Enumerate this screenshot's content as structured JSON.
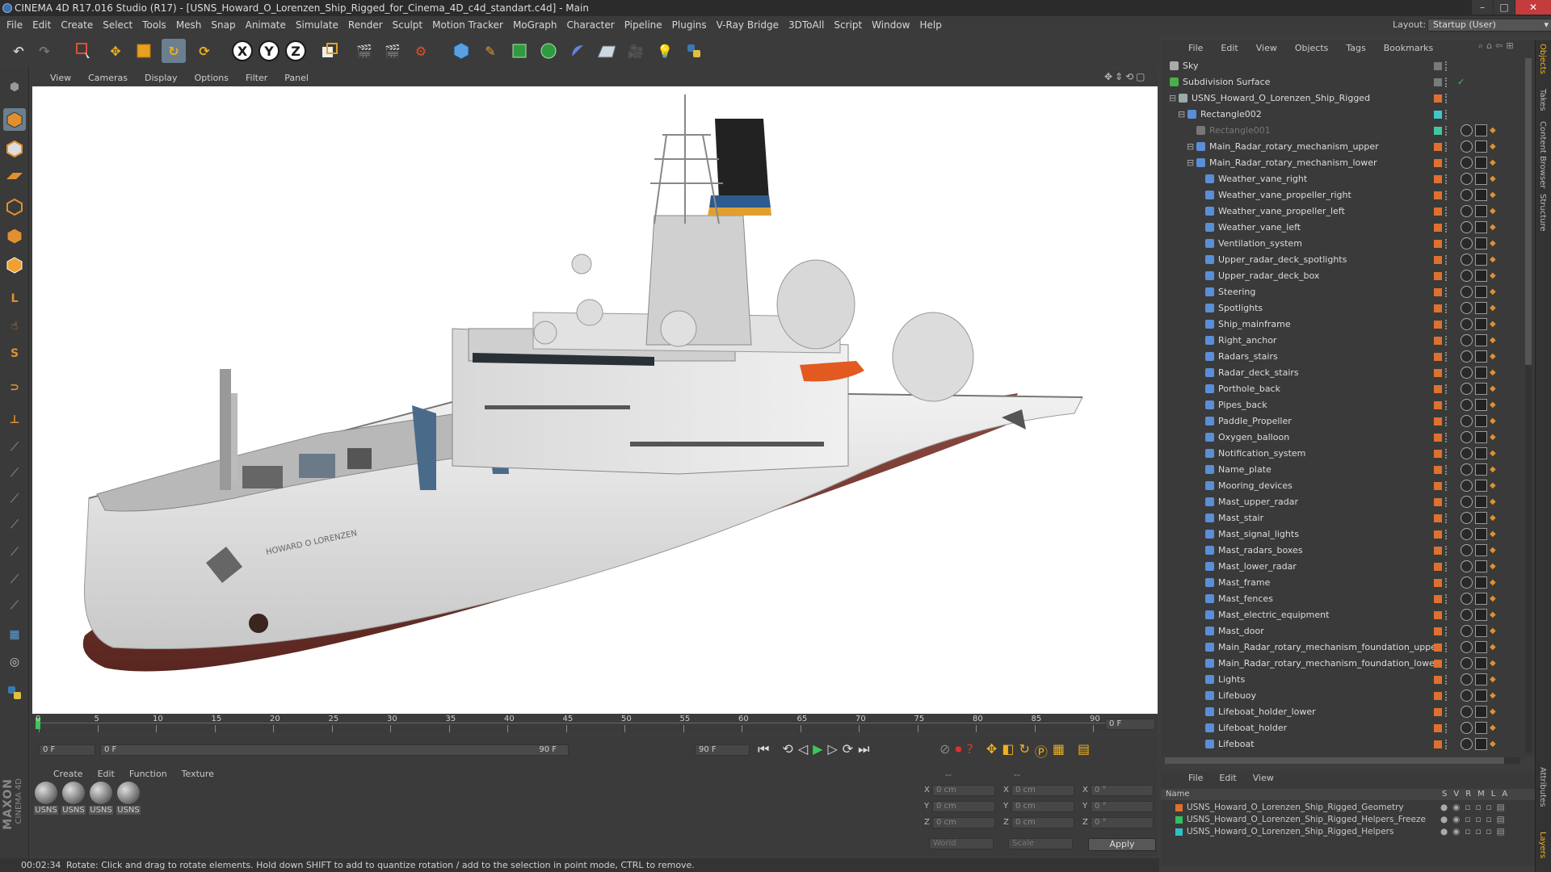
{
  "window": {
    "title": "CINEMA 4D R17.016 Studio (R17) - [USNS_Howard_O_Lorenzen_Ship_Rigged_for_Cinema_4D_c4d_standart.c4d] - Main",
    "min": "–",
    "max": "□",
    "close": "✕"
  },
  "menu": [
    "File",
    "Edit",
    "Create",
    "Select",
    "Tools",
    "Mesh",
    "Snap",
    "Animate",
    "Simulate",
    "Render",
    "Sculpt",
    "Motion Tracker",
    "MoGraph",
    "Character",
    "Pipeline",
    "Plugins",
    "V-Ray Bridge",
    "3DToAll",
    "Script",
    "Window",
    "Help"
  ],
  "layout": {
    "label": "Layout:",
    "value": "Startup (User)"
  },
  "toolbar": {
    "x_axis": "X",
    "y_axis": "Y",
    "z_axis": "Z"
  },
  "viewport_menu": [
    "View",
    "Cameras",
    "Display",
    "Options",
    "Filter",
    "Panel"
  ],
  "ship": {
    "name_plate": "HOWARD O LORENZEN"
  },
  "timeline": {
    "ticks": [
      "0",
      "5",
      "10",
      "15",
      "20",
      "25",
      "30",
      "35",
      "40",
      "45",
      "50",
      "55",
      "60",
      "65",
      "70",
      "75",
      "80",
      "85",
      "90"
    ],
    "current_frame_display": "0 F"
  },
  "timectrl": {
    "start": "0 F",
    "range_start": "0 F",
    "range_end": "90 F",
    "end": "90 F"
  },
  "materials": {
    "menu": [
      "Create",
      "Edit",
      "Function",
      "Texture"
    ],
    "items": [
      "USNS",
      "USNS",
      "USNS",
      "USNS"
    ]
  },
  "coords": {
    "labels": [
      "X",
      "Y",
      "Z",
      "X",
      "Y",
      "Z",
      "X",
      "Y",
      "Z"
    ],
    "values": [
      "0 cm",
      "0 cm",
      "0 cm",
      "0 cm",
      "0 cm",
      "0 cm",
      "0 °",
      "0 °",
      "0 °"
    ],
    "dash1": "--",
    "dash2": "--",
    "mode1": "World",
    "mode2": "Scale",
    "apply": "Apply"
  },
  "status": {
    "time": "00:02:34",
    "message": "Rotate: Click and drag to rotate elements. Hold down SHIFT to add to quantize rotation / add to the selection in point mode, CTRL to remove."
  },
  "objects_menu": [
    "File",
    "Edit",
    "View",
    "Objects",
    "Tags",
    "Bookmarks"
  ],
  "objects": [
    {
      "name": "Sky",
      "indent": 0,
      "color": "#7a7a7a",
      "icon": "#aaaaaa"
    },
    {
      "name": "Subdivision Surface",
      "indent": 0,
      "color": "#7a7a7a",
      "icon": "#48b04a"
    },
    {
      "name": "USNS_Howard_O_Lorenzen_Ship_Rigged",
      "indent": 1,
      "color": "#e07030",
      "icon": "#9aa"
    },
    {
      "name": "Rectangle002",
      "indent": 2,
      "color": "#40c8c8",
      "icon": "#5a8fd8"
    },
    {
      "name": "Rectangle001",
      "indent": 3,
      "color": "#40c8a0",
      "icon": "#777",
      "dim": true
    },
    {
      "name": "Main_Radar_rotary_mechanism_upper",
      "indent": 3,
      "color": "#e07030",
      "icon": "#5a8fd8"
    },
    {
      "name": "Main_Radar_rotary_mechanism_lower",
      "indent": 3,
      "color": "#e07030",
      "icon": "#5a8fd8"
    },
    {
      "name": "Weather_vane_right",
      "indent": 4,
      "color": "#e07030",
      "icon": "#5a8fd8"
    },
    {
      "name": "Weather_vane_propeller_right",
      "indent": 4,
      "color": "#e07030",
      "icon": "#5a8fd8"
    },
    {
      "name": "Weather_vane_propeller_left",
      "indent": 4,
      "color": "#e07030",
      "icon": "#5a8fd8"
    },
    {
      "name": "Weather_vane_left",
      "indent": 4,
      "color": "#e07030",
      "icon": "#5a8fd8"
    },
    {
      "name": "Ventilation_system",
      "indent": 4,
      "color": "#e07030",
      "icon": "#5a8fd8"
    },
    {
      "name": "Upper_radar_deck_spotlights",
      "indent": 4,
      "color": "#e07030",
      "icon": "#5a8fd8"
    },
    {
      "name": "Upper_radar_deck_box",
      "indent": 4,
      "color": "#e07030",
      "icon": "#5a8fd8"
    },
    {
      "name": "Steering",
      "indent": 4,
      "color": "#e07030",
      "icon": "#5a8fd8"
    },
    {
      "name": "Spotlights",
      "indent": 4,
      "color": "#e07030",
      "icon": "#5a8fd8"
    },
    {
      "name": "Ship_mainframe",
      "indent": 4,
      "color": "#e07030",
      "icon": "#5a8fd8"
    },
    {
      "name": "Right_anchor",
      "indent": 4,
      "color": "#e07030",
      "icon": "#5a8fd8"
    },
    {
      "name": "Radars_stairs",
      "indent": 4,
      "color": "#e07030",
      "icon": "#5a8fd8"
    },
    {
      "name": "Radar_deck_stairs",
      "indent": 4,
      "color": "#e07030",
      "icon": "#5a8fd8"
    },
    {
      "name": "Porthole_back",
      "indent": 4,
      "color": "#e07030",
      "icon": "#5a8fd8"
    },
    {
      "name": "Pipes_back",
      "indent": 4,
      "color": "#e07030",
      "icon": "#5a8fd8"
    },
    {
      "name": "Paddle_Propeller",
      "indent": 4,
      "color": "#e07030",
      "icon": "#5a8fd8"
    },
    {
      "name": "Oxygen_balloon",
      "indent": 4,
      "color": "#e07030",
      "icon": "#5a8fd8"
    },
    {
      "name": "Notification_system",
      "indent": 4,
      "color": "#e07030",
      "icon": "#5a8fd8"
    },
    {
      "name": "Name_plate",
      "indent": 4,
      "color": "#e07030",
      "icon": "#5a8fd8"
    },
    {
      "name": "Mooring_devices",
      "indent": 4,
      "color": "#e07030",
      "icon": "#5a8fd8"
    },
    {
      "name": "Mast_upper_radar",
      "indent": 4,
      "color": "#e07030",
      "icon": "#5a8fd8"
    },
    {
      "name": "Mast_stair",
      "indent": 4,
      "color": "#e07030",
      "icon": "#5a8fd8"
    },
    {
      "name": "Mast_signal_lights",
      "indent": 4,
      "color": "#e07030",
      "icon": "#5a8fd8"
    },
    {
      "name": "Mast_radars_boxes",
      "indent": 4,
      "color": "#e07030",
      "icon": "#5a8fd8"
    },
    {
      "name": "Mast_lower_radar",
      "indent": 4,
      "color": "#e07030",
      "icon": "#5a8fd8"
    },
    {
      "name": "Mast_frame",
      "indent": 4,
      "color": "#e07030",
      "icon": "#5a8fd8"
    },
    {
      "name": "Mast_fences",
      "indent": 4,
      "color": "#e07030",
      "icon": "#5a8fd8"
    },
    {
      "name": "Mast_electric_equipment",
      "indent": 4,
      "color": "#e07030",
      "icon": "#5a8fd8"
    },
    {
      "name": "Mast_door",
      "indent": 4,
      "color": "#e07030",
      "icon": "#5a8fd8"
    },
    {
      "name": "Main_Radar_rotary_mechanism_foundation_upper",
      "indent": 4,
      "color": "#e07030",
      "icon": "#5a8fd8"
    },
    {
      "name": "Main_Radar_rotary_mechanism_foundation_lower",
      "indent": 4,
      "color": "#e07030",
      "icon": "#5a8fd8"
    },
    {
      "name": "Lights",
      "indent": 4,
      "color": "#e07030",
      "icon": "#5a8fd8"
    },
    {
      "name": "Lifebuoy",
      "indent": 4,
      "color": "#e07030",
      "icon": "#5a8fd8"
    },
    {
      "name": "Lifeboat_holder_lower",
      "indent": 4,
      "color": "#e07030",
      "icon": "#5a8fd8"
    },
    {
      "name": "Lifeboat_holder",
      "indent": 4,
      "color": "#e07030",
      "icon": "#5a8fd8"
    },
    {
      "name": "Lifeboat",
      "indent": 4,
      "color": "#e07030",
      "icon": "#5a8fd8"
    }
  ],
  "layers": {
    "menu": [
      "File",
      "Edit",
      "View"
    ],
    "header": {
      "name": "Name",
      "cols": [
        "S",
        "V",
        "R",
        "M",
        "L",
        "A"
      ]
    },
    "items": [
      {
        "name": "USNS_Howard_O_Lorenzen_Ship_Rigged_Geometry",
        "color": "#e07030"
      },
      {
        "name": "USNS_Howard_O_Lorenzen_Ship_Rigged_Helpers_Freeze",
        "color": "#30c060"
      },
      {
        "name": "USNS_Howard_O_Lorenzen_Ship_Rigged_Helpers",
        "color": "#30c0c8"
      }
    ]
  },
  "right_tabs": [
    "Objects",
    "Takes",
    "Content Browser",
    "Structure",
    "Attributes",
    "Layers"
  ],
  "maxon": {
    "line1": "MAXON",
    "line2": "CINEMA 4D"
  }
}
